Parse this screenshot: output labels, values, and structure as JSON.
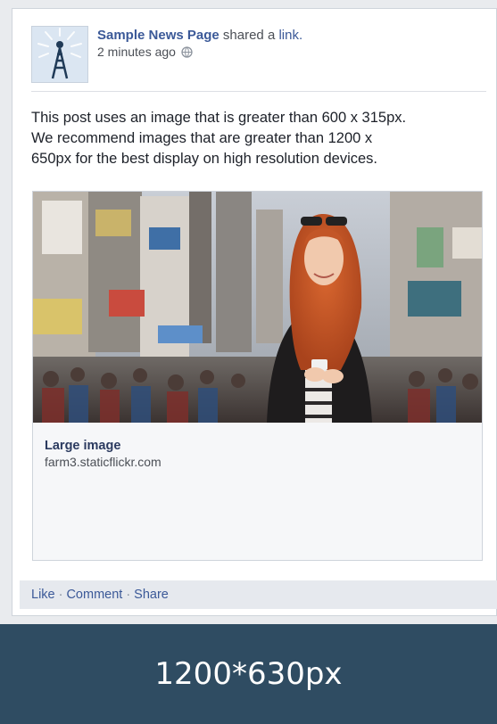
{
  "post": {
    "page_name": "Sample News Page",
    "shared_text": "shared a",
    "link_word": "link.",
    "timestamp": "2 minutes ago",
    "avatar_icon": "radio-tower-icon",
    "privacy_icon": "globe-icon",
    "body_lines": [
      "This post uses an image that is greater than 600 x 315px.",
      "We recommend images that are greater than 1200 x",
      "650px for the best display on high resolution devices."
    ]
  },
  "link_preview": {
    "title": "Large image",
    "domain": "farm3.staticflickr.com"
  },
  "actions": {
    "like": "Like",
    "comment": "Comment",
    "share": "Share",
    "separator": "·"
  },
  "banner": {
    "text": "1200*630px"
  },
  "colors": {
    "link_blue": "#3b5998",
    "banner_bg": "#2f4c62",
    "page_bg": "#e9ebee"
  }
}
